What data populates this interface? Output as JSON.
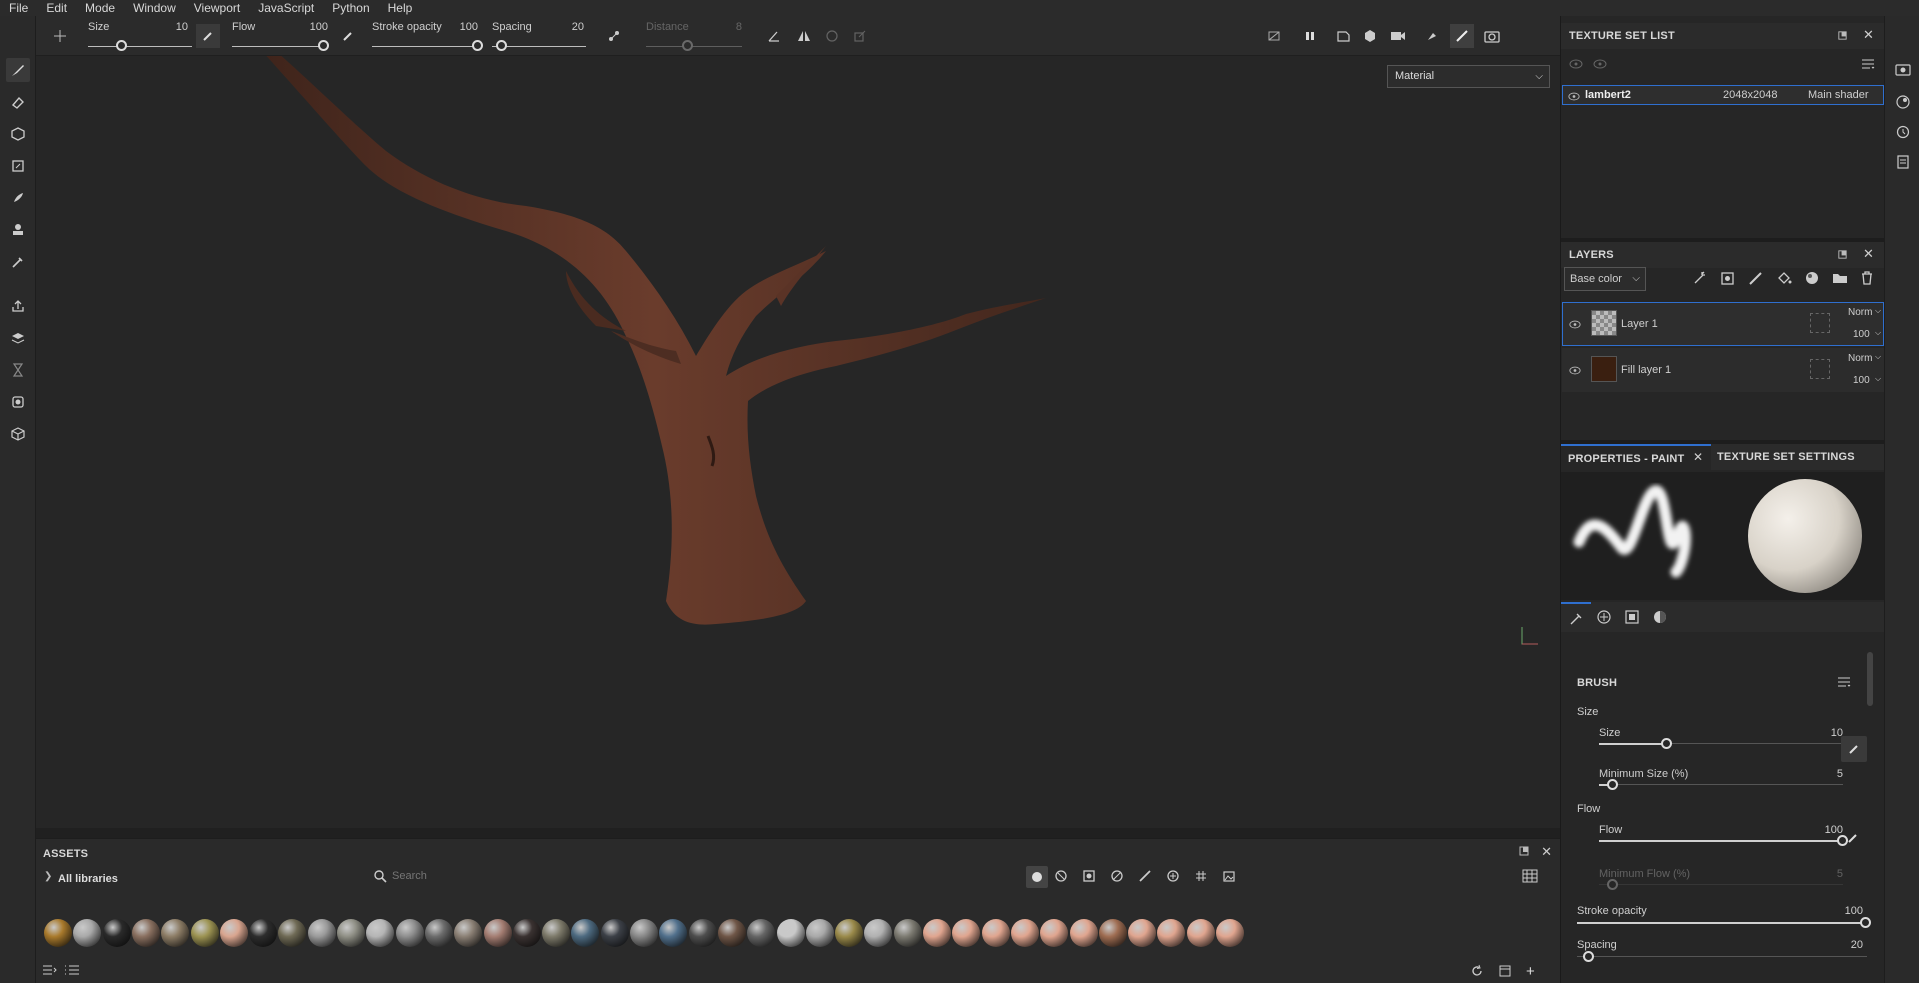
{
  "menu": [
    "File",
    "Edit",
    "Mode",
    "Window",
    "Viewport",
    "JavaScript",
    "Python",
    "Help"
  ],
  "toolbar": {
    "size_label": "Size",
    "size_value": "10",
    "flow_label": "Flow",
    "flow_value": "100",
    "stroke_opacity_label": "Stroke opacity",
    "stroke_opacity_value": "100",
    "spacing_label": "Spacing",
    "spacing_value": "20",
    "distance_label": "Distance",
    "distance_value": "8"
  },
  "viewport": {
    "material_select": "Material"
  },
  "assets": {
    "title": "ASSETS",
    "all_libraries": "All libraries",
    "search_placeholder": "Search",
    "material_colors": [
      "#a97a2c",
      "#a9a9a9",
      "#2a2a2a",
      "#8a7060",
      "#8d7d66",
      "#9c9352",
      "#d9a58f",
      "#2d2d2d",
      "#6f6a55",
      "#9a9a9a",
      "#8f8f85",
      "#b5b5b5",
      "#8e8e8e",
      "#6c6c6c",
      "#8b8075",
      "#a47d72",
      "#3a3231",
      "#7d7a6a",
      "#4d6a80",
      "#3c4047",
      "#888888",
      "#51708c",
      "#4e4e4e",
      "#6f5647",
      "#656565",
      "#c9c9c9",
      "#a9a9a9",
      "#9a8a4a",
      "#b1b1b1",
      "#7d7b72",
      "#e0a58f",
      "#e0a58f",
      "#e0a58f",
      "#e0a58f",
      "#e0a58f",
      "#e0a58f",
      "#9f6d52",
      "#e0a58f",
      "#e0a58f",
      "#e0a58f",
      "#e0a58f"
    ]
  },
  "texture_set_list": {
    "title": "TEXTURE SET LIST",
    "item_name": "lambert2",
    "item_res": "2048x2048",
    "item_shader": "Main shader"
  },
  "layers": {
    "title": "LAYERS",
    "channel": "Base color",
    "items": [
      {
        "name": "Layer 1",
        "blend": "Norm",
        "opacity": "100"
      },
      {
        "name": "Fill layer 1",
        "blend": "Norm",
        "opacity": "100"
      }
    ]
  },
  "properties": {
    "tab_paint": "PROPERTIES - PAINT",
    "tab_texture_set": "TEXTURE SET SETTINGS",
    "brush_title": "BRUSH",
    "size_group": "Size",
    "size_label": "Size",
    "size_value": "10",
    "min_size_label": "Minimum Size (%)",
    "min_size_value": "5",
    "flow_group": "Flow",
    "flow_label": "Flow",
    "flow_value": "100",
    "min_flow_label": "Minimum Flow (%)",
    "min_flow_value": "5",
    "stroke_opacity_label": "Stroke opacity",
    "stroke_opacity_value": "100",
    "spacing_label": "Spacing",
    "spacing_value": "20"
  },
  "colors": {
    "accent": "#2f6fcf",
    "fill_layer": "#3a1f10",
    "trunk": "#5a3326"
  }
}
